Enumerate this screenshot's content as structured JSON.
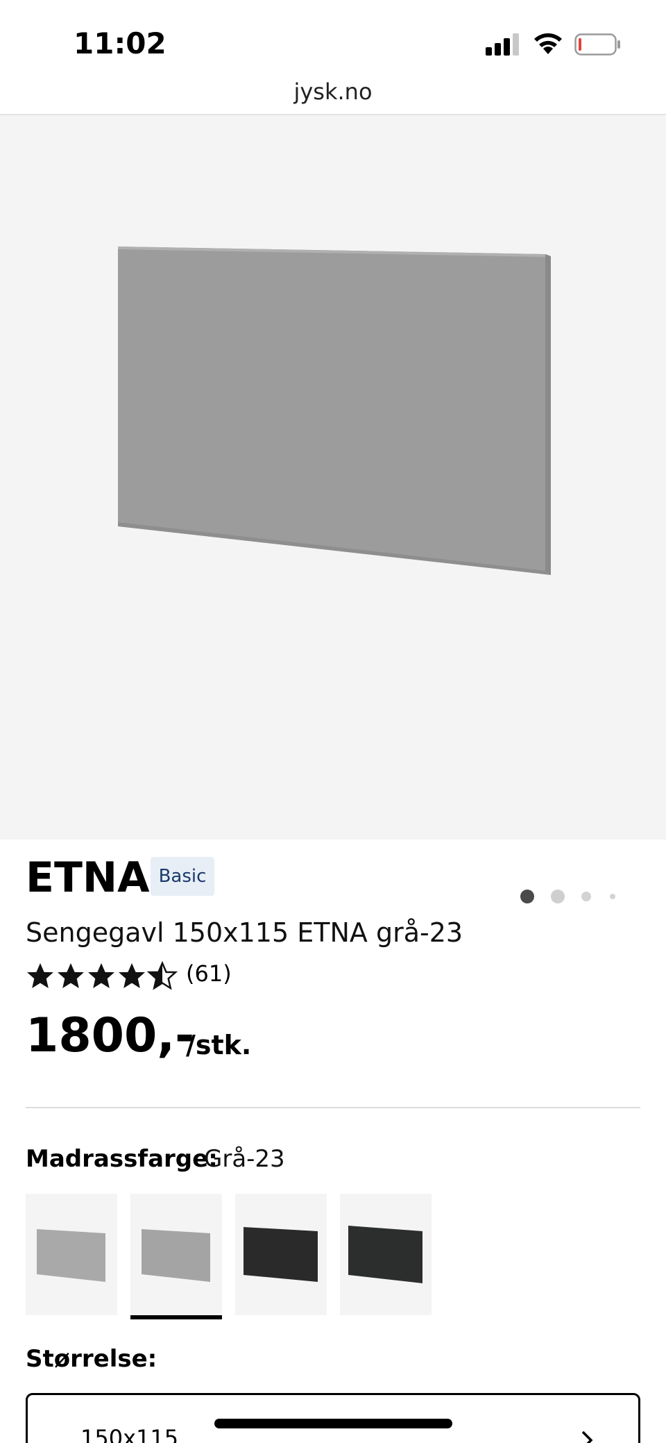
{
  "status_bar": {
    "time": "11:02",
    "icons": [
      "signal-icon",
      "wifi-icon",
      "battery-icon"
    ]
  },
  "browser": {
    "url": "jysk.no"
  },
  "gallery": {
    "image_count": 4,
    "active_index": 0
  },
  "product": {
    "brand": "ETNA",
    "badge": "Basic",
    "name": "Sengegavl 150x115 ETNA grå-23",
    "rating": 4.5,
    "review_count": "(61)",
    "price": "1800,-",
    "unit": "/stk."
  },
  "color_selector": {
    "label": "Madrassfarge:",
    "value": "Grå-23",
    "options": [
      {
        "name": "grå-light",
        "color": "#a9a9a9"
      },
      {
        "name": "grå-23",
        "color": "#a4a4a4",
        "selected": true
      },
      {
        "name": "black",
        "color": "#2a2a2a"
      },
      {
        "name": "anthracite",
        "color": "#2b2e2d"
      }
    ]
  },
  "size_selector": {
    "label": "Størrelse:",
    "value": "150x115"
  },
  "colors": {
    "hero_background": "#f4f4f4",
    "badge_background": "#e7eef6",
    "badge_text": "#1b3a6b",
    "headboard_grey": "#9c9c9c"
  }
}
